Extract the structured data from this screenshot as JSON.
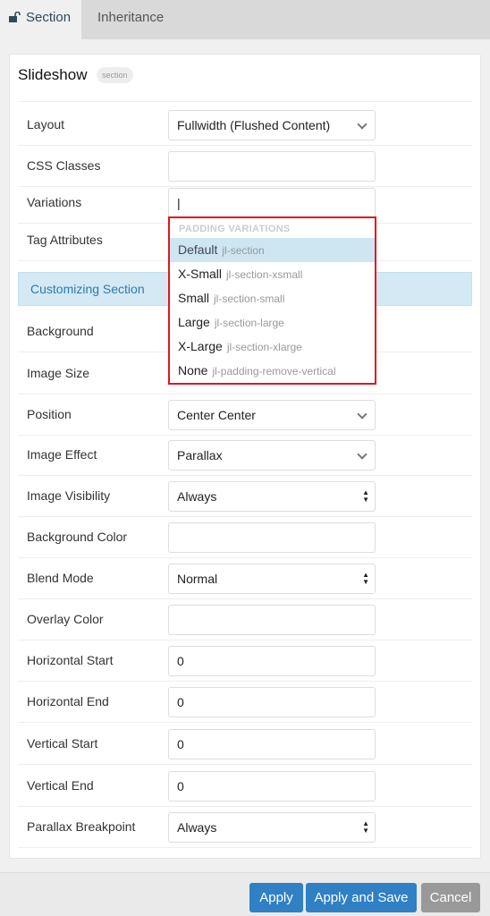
{
  "tabs": [
    {
      "label": "Section",
      "icon": "unlock-icon"
    },
    {
      "label": "Inheritance"
    }
  ],
  "panel": {
    "title": "Slideshow",
    "badge": "section"
  },
  "fields_top": [
    {
      "label": "Layout",
      "value": "Fullwidth (Flushed Content)",
      "type": "select"
    },
    {
      "label": "CSS Classes",
      "value": "",
      "type": "text"
    },
    {
      "label": "Variations",
      "value": "|",
      "type": "text"
    },
    {
      "label": "Tag Attributes",
      "value": "",
      "type": "text"
    }
  ],
  "section_header": "Customizing Section",
  "fields": [
    {
      "label": "Background",
      "value": "",
      "type": "hidden"
    },
    {
      "label": "Image Size",
      "value": "",
      "type": "hidden"
    },
    {
      "label": "Position",
      "value": "Center Center",
      "type": "select"
    },
    {
      "label": "Image Effect",
      "value": "Parallax",
      "type": "select"
    },
    {
      "label": "Image Visibility",
      "value": "Always",
      "type": "native"
    },
    {
      "label": "Background Color",
      "value": "",
      "type": "text"
    },
    {
      "label": "Blend Mode",
      "value": "Normal",
      "type": "native"
    },
    {
      "label": "Overlay Color",
      "value": "",
      "type": "text"
    },
    {
      "label": "Horizontal Start",
      "value": "0",
      "type": "text"
    },
    {
      "label": "Horizontal End",
      "value": "0",
      "type": "text"
    },
    {
      "label": "Vertical Start",
      "value": "0",
      "type": "text"
    },
    {
      "label": "Vertical End",
      "value": "0",
      "type": "text"
    },
    {
      "label": "Parallax Breakpoint",
      "value": "Always",
      "type": "native"
    }
  ],
  "dropdown": {
    "header": "PADDING VARIATIONS",
    "options": [
      {
        "label": "Default",
        "class": "jl-section",
        "selected": true
      },
      {
        "label": "X-Small",
        "class": "jl-section-xsmall"
      },
      {
        "label": "Small",
        "class": "jl-section-small"
      },
      {
        "label": "Large",
        "class": "jl-section-large"
      },
      {
        "label": "X-Large",
        "class": "jl-section-xlarge"
      },
      {
        "label": "None",
        "class": "jl-padding-remove-vertical"
      }
    ]
  },
  "footer": {
    "apply": "Apply",
    "apply_save": "Apply and Save",
    "cancel": "Cancel"
  },
  "colors": {
    "primary": "#2f80c5",
    "cancel": "#999999",
    "highlight": "#e0161e"
  }
}
